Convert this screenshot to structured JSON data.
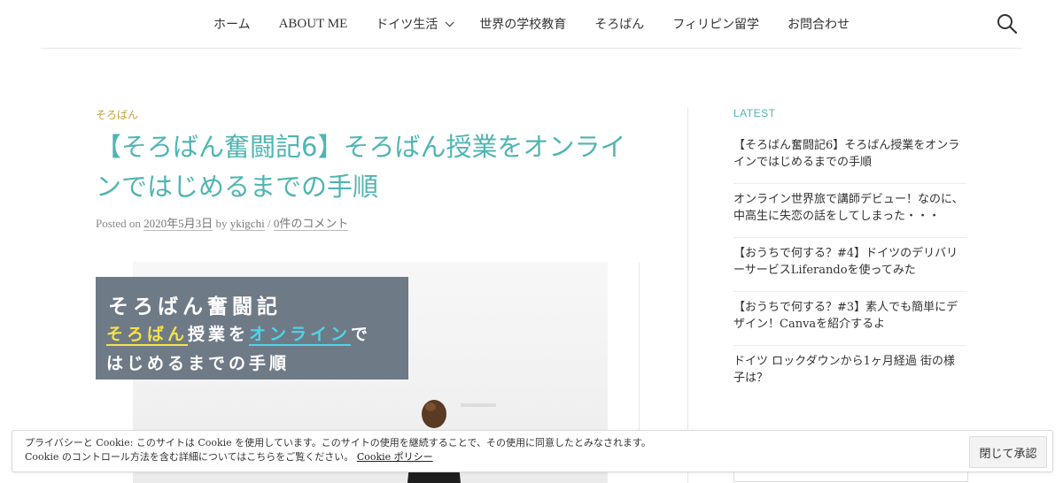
{
  "nav": {
    "items": [
      {
        "label": "ホーム"
      },
      {
        "label": "ABOUT ME"
      },
      {
        "label": "ドイツ生活"
      },
      {
        "label": "世界の学校教育"
      },
      {
        "label": "そろばん"
      },
      {
        "label": "フィリピン留学"
      },
      {
        "label": "お問合わせ"
      }
    ]
  },
  "article": {
    "category": "そろばん",
    "title": "【そろばん奮闘記6】そろばん授業をオンラインではじめるまでの手順",
    "meta": {
      "posted_on": "Posted on",
      "date": "2020年5月3日",
      "by": "by",
      "author": "ykigchi",
      "sep": "/",
      "comments": "0件のコメント"
    },
    "image": {
      "line1": "そろばん奮闘記",
      "line2_a": "そろばん",
      "line2_b": "授業を",
      "line2_c": "オンライン",
      "line2_d": "で",
      "line3": "はじめるまでの手順"
    }
  },
  "sidebar": {
    "heading": "LATEST",
    "items": [
      {
        "label": "【そろばん奮闘記6】そろばん授業をオンラインではじめるまでの手順"
      },
      {
        "label": "オンライン世界旅で講師デビュー！なのに、中高生に失恋の話をしてしまった・・・"
      },
      {
        "label": "【おうちで何する？#4】ドイツのデリバリーサービスLiferandoを使ってみた"
      },
      {
        "label": "【おうちで何する？#3】素人でも簡単にデザイン！Canvaを紹介するよ"
      },
      {
        "label": "ドイツ ロックダウンから1ヶ月経過 街の様子は？"
      }
    ]
  },
  "cookie": {
    "line1": "プライバシーと Cookie: このサイトは Cookie を使用しています。このサイトの使用を継続することで、その使用に同意したとみなされます。",
    "line2": "Cookie のコントロール方法を含む詳細についてはこちらをご覧ください。",
    "link": "Cookie ポリシー",
    "button": "閉じて承認"
  },
  "colors": {
    "accent": "#4fb5b2",
    "category": "#c8a135",
    "banner": "#6f7a87"
  }
}
